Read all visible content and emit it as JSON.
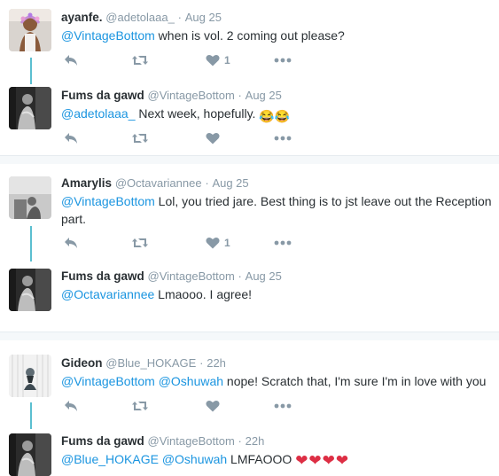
{
  "threads": [
    {
      "tweets": [
        {
          "fullname": "ayanfe.",
          "username": "@adetolaaa_",
          "dot": "·",
          "time": "Aug 25",
          "mention": "@VintageBottom",
          "text": " when is vol. 2 coming out please?",
          "like_count": "1"
        },
        {
          "fullname": "Fums da gawd",
          "username": "@VintageBottom",
          "dot": "·",
          "time": "Aug 25",
          "mention": "@adetolaaa_",
          "text": " Next week, hopefully. ",
          "emoji": "😂😂",
          "like_count": ""
        }
      ]
    },
    {
      "tweets": [
        {
          "fullname": "Amarylis",
          "username": "@Octavariannee",
          "dot": "·",
          "time": "Aug 25",
          "mention": "@VintageBottom",
          "text": " Lol, you tried jare. Best thing is to jst leave out the Reception part.",
          "like_count": "1"
        },
        {
          "fullname": "Fums da gawd",
          "username": "@VintageBottom",
          "dot": "·",
          "time": "Aug 25",
          "mention": "@Octavariannee",
          "text": " Lmaooo. I agree!",
          "like_count": ""
        }
      ]
    },
    {
      "tweets": [
        {
          "fullname": "Gideon",
          "username": "@Blue_HOKAGE",
          "dot": "·",
          "time": "22h",
          "mention": "@VintageBottom",
          "mention2": "@Oshuwah",
          "text": " nope! Scratch that, I'm sure I'm in love with you",
          "like_count": ""
        },
        {
          "fullname": "Fums da gawd",
          "username": "@VintageBottom",
          "dot": "·",
          "time": "22h",
          "mention": "@Blue_HOKAGE",
          "mention2": "@Oshuwah",
          "text": " LMFAOOO ",
          "emoji": "❤❤❤❤",
          "like_count": ""
        }
      ]
    }
  ],
  "icons": {
    "reply": "reply-icon",
    "retweet": "retweet-icon",
    "like": "heart-icon",
    "more": "more-icon"
  },
  "colors": {
    "mention": "#1b95e0",
    "connector": "#5bbfd0",
    "muted": "#8899a6",
    "separator": "#f5f8fa",
    "heart_emoji": "#dd2e44"
  }
}
